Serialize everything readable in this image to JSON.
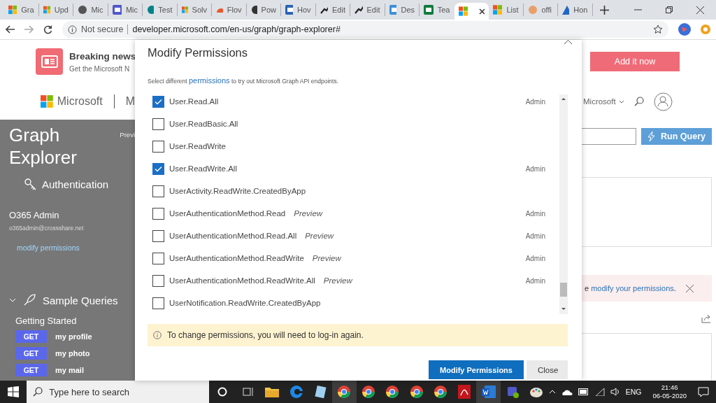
{
  "browser": {
    "tabs": [
      {
        "title": "Gra",
        "kind": "ms",
        "selected": false
      },
      {
        "title": "Upd",
        "kind": "ms",
        "selected": false
      },
      {
        "title": "Mic",
        "kind": "circle",
        "color": "#555555",
        "selected": false
      },
      {
        "title": "Mic",
        "kind": "square",
        "color": "#5059c9",
        "selected": false
      },
      {
        "title": "Test",
        "kind": "circle",
        "color": "#038387",
        "selected": false
      },
      {
        "title": "Solv",
        "kind": "ms",
        "selected": false
      },
      {
        "title": "Flov",
        "kind": "cloud",
        "color": "#e8572f",
        "selected": false
      },
      {
        "title": "Pow",
        "kind": "circle",
        "color": "#333333",
        "selected": false
      },
      {
        "title": "Hov",
        "kind": "square",
        "color": "#2b63b5",
        "selected": false
      },
      {
        "title": "Edit",
        "kind": "line",
        "color": "#222222",
        "selected": false
      },
      {
        "title": "Edit",
        "kind": "line",
        "color": "#222222",
        "selected": false
      },
      {
        "title": "Des",
        "kind": "square",
        "color": "#3c8fd8",
        "selected": false
      },
      {
        "title": "Tea",
        "kind": "square",
        "color": "#117a3d",
        "selected": false
      },
      {
        "kind": "ms",
        "selected": true
      },
      {
        "title": "List",
        "kind": "ms",
        "selected": false
      },
      {
        "title": "offi",
        "kind": "circle",
        "color": "#e8a06b",
        "selected": false
      },
      {
        "title": "Hon",
        "kind": "triangle",
        "color": "#2266c4",
        "selected": false
      }
    ],
    "address": {
      "security": "Not secure",
      "url": "developer.microsoft.com/en-us/graph/graph-explorer#"
    }
  },
  "banner": {
    "title": "Breaking news",
    "subtitle": "Get the Microsoft N",
    "action": "Add it now"
  },
  "header": {
    "brand": "Microsoft",
    "section": "M",
    "menu": "Microsoft"
  },
  "sidebar": {
    "title_lines": [
      "Graph",
      "Explorer"
    ],
    "preview": "Previ",
    "auth": "Authentication",
    "user_name": "O365 Admin",
    "user_email": "o365admin@crossshare.net",
    "modify_link": "modify permissions",
    "samples": "Sample Queries",
    "group": "Getting Started",
    "queries": [
      {
        "method": "GET",
        "label": "my profile"
      },
      {
        "method": "GET",
        "label": "my photo"
      },
      {
        "method": "GET",
        "label": "my mail"
      }
    ]
  },
  "query": {
    "run": "Run Query"
  },
  "notice": {
    "prefix": "e",
    "link": "modify your permissions",
    "suffix": "."
  },
  "dialog": {
    "title": "Modify Permissions",
    "intro_before": "Select different",
    "intro_link": "permissions",
    "intro_after": "to try out Microsoft Graph API endpoints.",
    "permissions": [
      {
        "name": "User.Read.All",
        "checked": true,
        "consent": "Admin"
      },
      {
        "name": "User.ReadBasic.All",
        "checked": false
      },
      {
        "name": "User.ReadWrite",
        "checked": false
      },
      {
        "name": "User.ReadWrite.All",
        "checked": true,
        "consent": "Admin"
      },
      {
        "name": "UserActivity.ReadWrite.CreatedByApp",
        "checked": false
      },
      {
        "name": "UserAuthenticationMethod.Read",
        "tag": "Preview",
        "checked": false,
        "consent": "Admin"
      },
      {
        "name": "UserAuthenticationMethod.Read.All",
        "tag": "Preview",
        "checked": false,
        "consent": "Admin"
      },
      {
        "name": "UserAuthenticationMethod.ReadWrite",
        "tag": "Preview",
        "checked": false,
        "consent": "Admin"
      },
      {
        "name": "UserAuthenticationMethod.ReadWrite.All",
        "tag": "Preview",
        "checked": false,
        "consent": "Admin"
      },
      {
        "name": "UserNotification.ReadWrite.CreatedByApp",
        "checked": false
      }
    ],
    "info": "To change permissions, you will need to log-in again.",
    "buttons": [
      {
        "label": "Modify Permissions",
        "kind": "primary"
      },
      {
        "label": "Close",
        "kind": "secondary"
      }
    ]
  },
  "taskbar": {
    "search_placeholder": "Type here to search",
    "apps": [
      {
        "kind": "folder",
        "active": false
      },
      {
        "kind": "edge",
        "active": false
      },
      {
        "kind": "notepad",
        "active": false
      },
      {
        "kind": "chrome",
        "active": true
      },
      {
        "kind": "chrome",
        "active": false
      },
      {
        "kind": "chrome",
        "active": false
      },
      {
        "kind": "chrome",
        "active": false
      },
      {
        "kind": "chrome",
        "active": false
      },
      {
        "kind": "pdf",
        "active": false
      },
      {
        "kind": "word",
        "active": true
      },
      {
        "kind": "teams",
        "active": false
      },
      {
        "kind": "paint",
        "active": false
      }
    ],
    "language": "ENG",
    "time": "21:46",
    "date": "06-05-2020"
  }
}
